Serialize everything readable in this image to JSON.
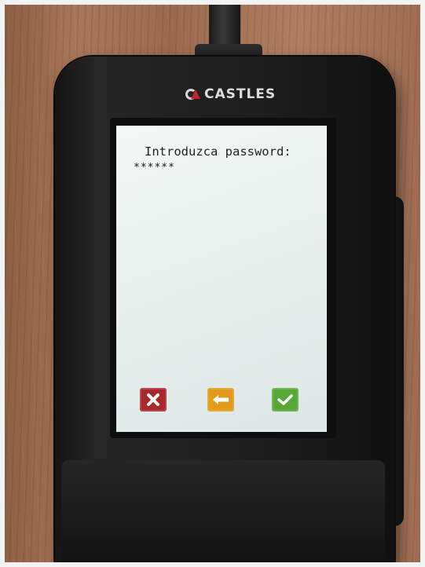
{
  "device": {
    "brand": "CASTLES"
  },
  "screen": {
    "prompt": "Introduzca password:",
    "password_masked": "******"
  },
  "buttons": {
    "cancel": {
      "icon": "close-icon",
      "color": "#a8282e"
    },
    "back": {
      "icon": "backspace-arrow-icon",
      "color": "#e29b1a"
    },
    "ok": {
      "icon": "checkmark-icon",
      "color": "#58a838"
    }
  }
}
